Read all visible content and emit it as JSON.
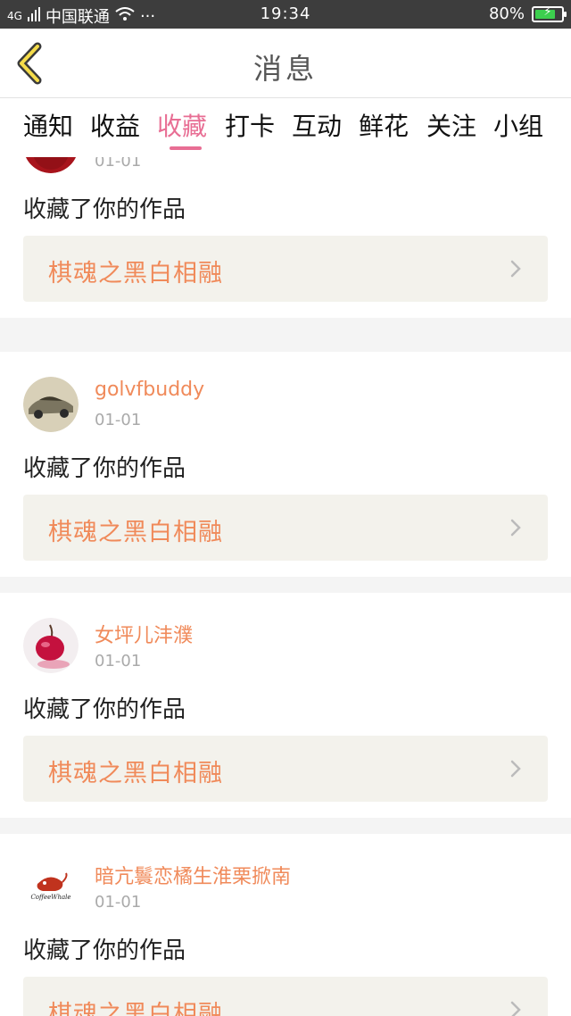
{
  "status_bar": {
    "carrier": "中国联通",
    "network": "4G",
    "time": "19:34",
    "battery": "80%",
    "battery_level": 0.8,
    "more": "···"
  },
  "header": {
    "title": "消息"
  },
  "tabs": [
    {
      "label": "通知"
    },
    {
      "label": "收益"
    },
    {
      "label": "收藏"
    },
    {
      "label": "打卡"
    },
    {
      "label": "互动"
    },
    {
      "label": "鲜花"
    },
    {
      "label": "关注"
    },
    {
      "label": "小组"
    }
  ],
  "active_tab": "收藏",
  "colors": {
    "accent": "#e86e94",
    "username": "#f08a5a",
    "work_bg": "#f3f2ec"
  },
  "items": [
    {
      "username": "",
      "date": "01-01",
      "action": "收藏了你的作品",
      "work": "棋魂之黑白相融",
      "avatar_icon": "red-circle-avatar-icon"
    },
    {
      "username": "golvfbuddy",
      "date": "01-01",
      "action": "收藏了你的作品",
      "work": "棋魂之黑白相融",
      "avatar_icon": "car-avatar-icon"
    },
    {
      "username": "女坪儿沣濮",
      "date": "01-01",
      "action": "收藏了你的作品",
      "work": "棋魂之黑白相融",
      "avatar_icon": "cherry-avatar-icon"
    },
    {
      "username": "暗亢鬟恋橘生淮栗掀南",
      "date": "01-01",
      "action": "收藏了你的作品",
      "work": "棋魂之黑白相融",
      "avatar_icon": "coffee-whale-avatar-icon",
      "avatar_text": "CoffeeWhale"
    }
  ]
}
